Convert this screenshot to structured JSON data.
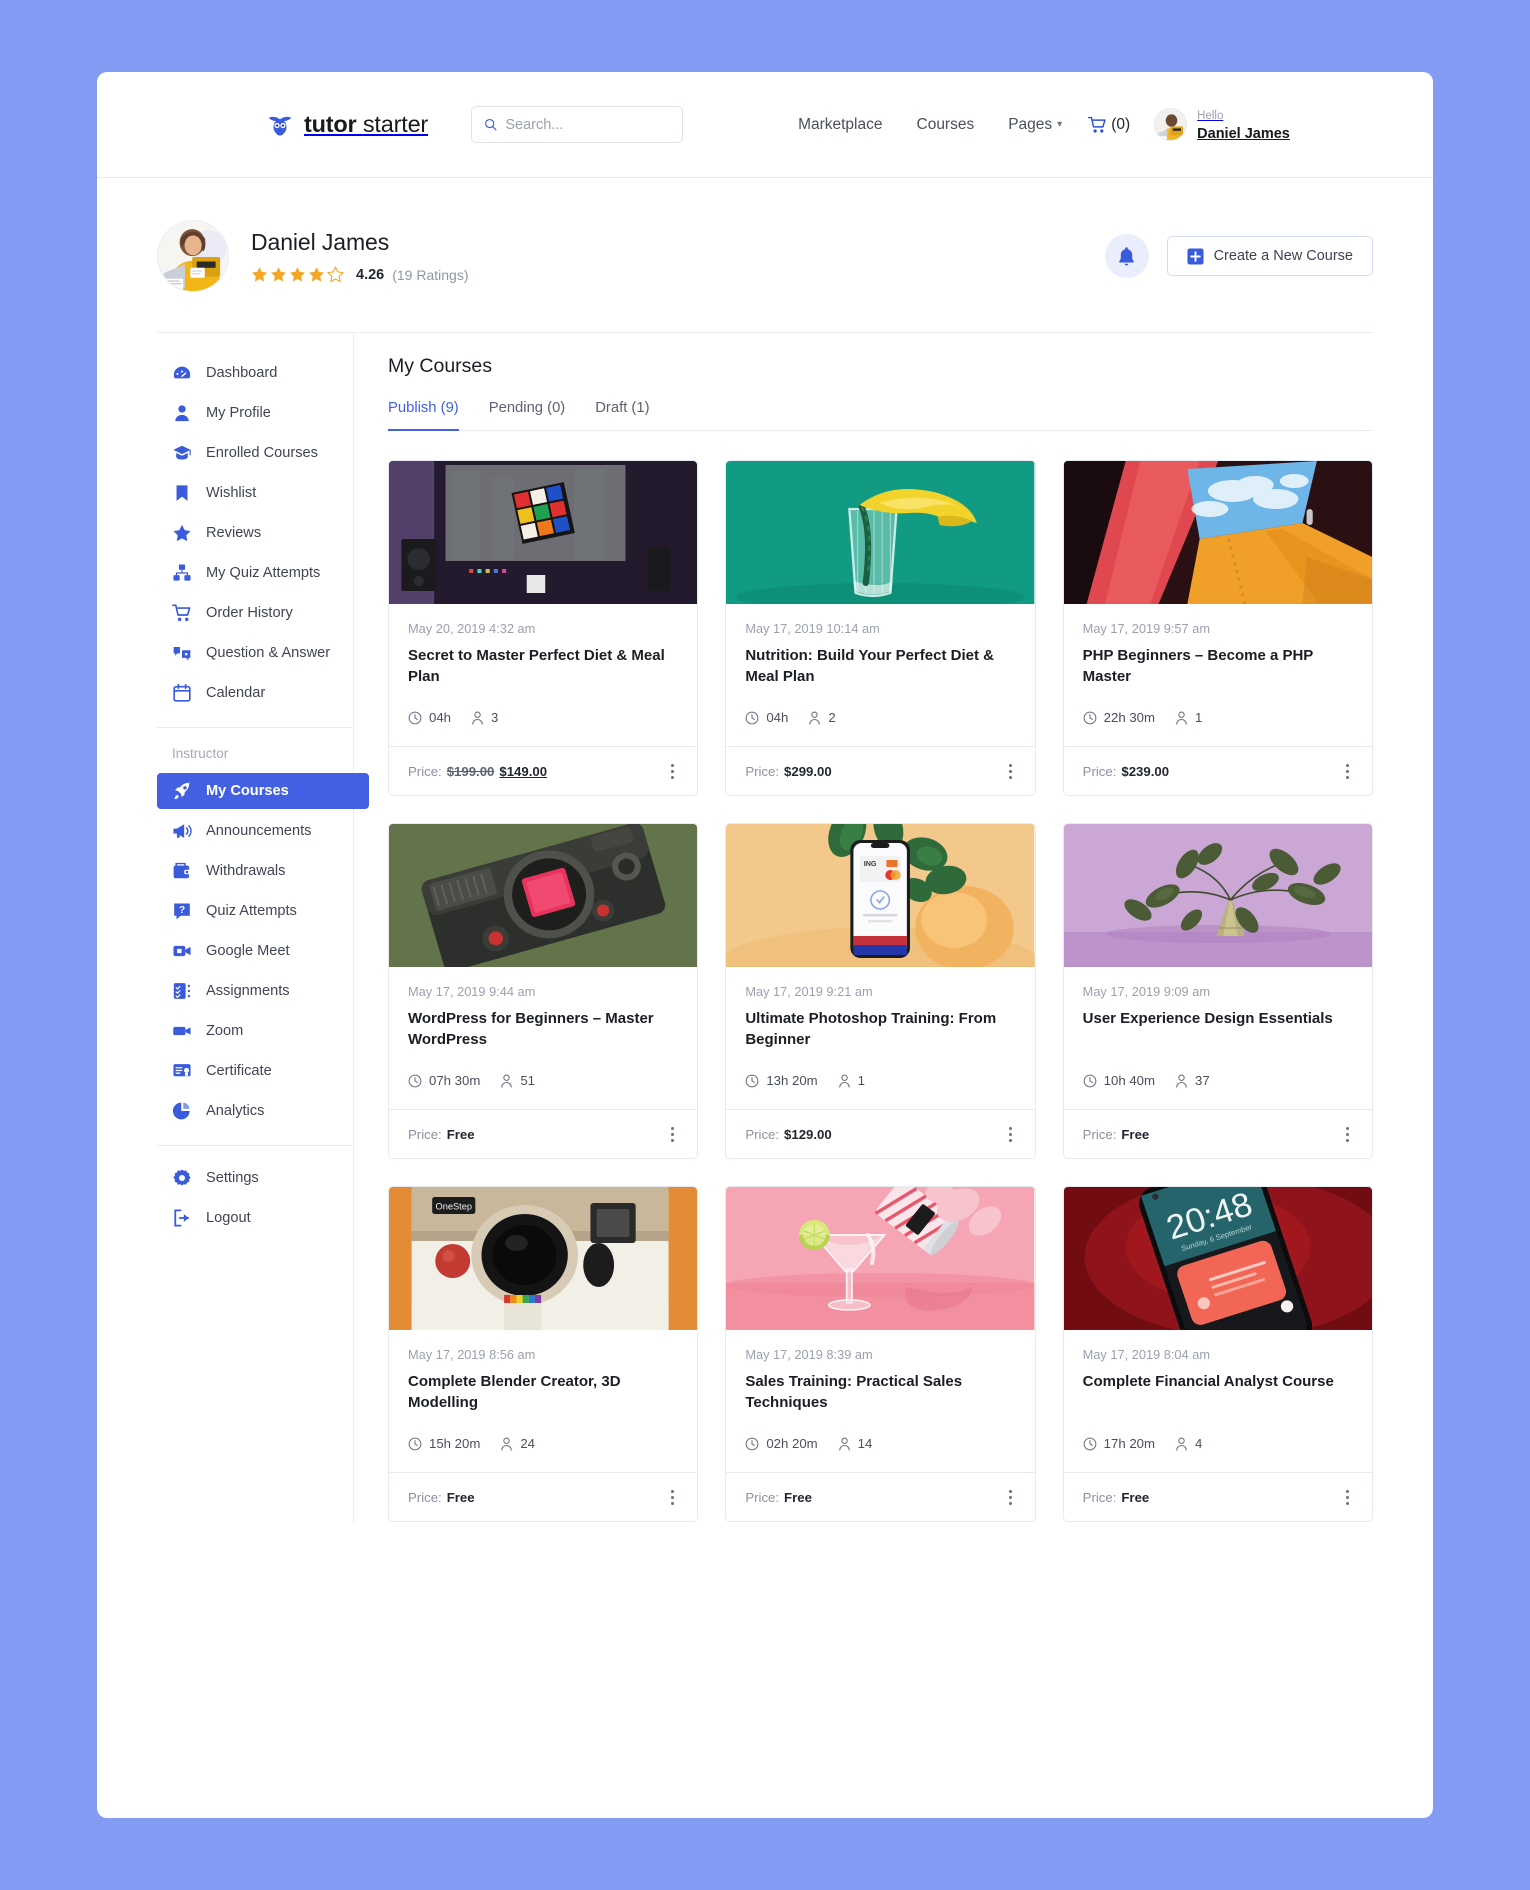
{
  "brand": {
    "name_bold": "tutor",
    "name_light": "starter",
    "icon": "owl-icon"
  },
  "search": {
    "placeholder": "Search...",
    "value": ""
  },
  "nav": {
    "items": [
      {
        "label": "Marketplace",
        "has_caret": false
      },
      {
        "label": "Courses",
        "has_caret": false
      },
      {
        "label": "Pages",
        "has_caret": true
      }
    ],
    "cart_label": "(0)",
    "cart_icon": "shopping-cart-icon",
    "hello": "Hello",
    "user_name": "Daniel James"
  },
  "profile": {
    "name": "Daniel James",
    "rating_value": "4.26",
    "rating_count": "(19 Ratings)",
    "stars_filled": 4,
    "stars_total": 5,
    "star_color": "#f5a623",
    "bell_icon": "bell-icon",
    "create_button": "Create a New Course",
    "create_icon": "plus-square-icon"
  },
  "sidebar": {
    "group1": [
      {
        "label": "Dashboard",
        "icon": "dashboard-icon"
      },
      {
        "label": "My Profile",
        "icon": "user-icon"
      },
      {
        "label": "Enrolled Courses",
        "icon": "graduation-cap-icon"
      },
      {
        "label": "Wishlist",
        "icon": "bookmark-icon"
      },
      {
        "label": "Reviews",
        "icon": "star-icon"
      },
      {
        "label": "My Quiz Attempts",
        "icon": "quiz-grid-icon"
      },
      {
        "label": "Order History",
        "icon": "cart-icon"
      },
      {
        "label": "Question & Answer",
        "icon": "question-answer-icon"
      },
      {
        "label": "Calendar",
        "icon": "calendar-icon"
      }
    ],
    "instructor_heading": "Instructor",
    "group2": [
      {
        "label": "My Courses",
        "icon": "rocket-icon",
        "active": true
      },
      {
        "label": "Announcements",
        "icon": "megaphone-icon",
        "active": false
      },
      {
        "label": "Withdrawals",
        "icon": "wallet-icon",
        "active": false
      },
      {
        "label": "Quiz Attempts",
        "icon": "quiz-question-icon",
        "active": false
      },
      {
        "label": "Google Meet",
        "icon": "video-camera-icon",
        "active": false
      },
      {
        "label": "Assignments",
        "icon": "assignment-list-icon",
        "active": false
      },
      {
        "label": "Zoom",
        "icon": "zoom-video-icon",
        "active": false
      },
      {
        "label": "Certificate",
        "icon": "certificate-icon",
        "active": false
      },
      {
        "label": "Analytics",
        "icon": "pie-chart-icon",
        "active": false
      }
    ],
    "group3": [
      {
        "label": "Settings",
        "icon": "gear-icon"
      },
      {
        "label": "Logout",
        "icon": "logout-icon"
      }
    ]
  },
  "main": {
    "title": "My Courses",
    "tabs": [
      {
        "label": "Publish (9)",
        "active": true
      },
      {
        "label": "Pending (0)",
        "active": false
      },
      {
        "label": "Draft (1)",
        "active": false
      }
    ],
    "price_label": "Price:",
    "clock_icon": "clock-icon",
    "student_icon": "student-icon",
    "kebab_icon": "more-vertical-icon"
  },
  "courses": [
    {
      "date": "May 20, 2019 4:32 am",
      "title": "Secret to Master Perfect Diet & Meal Plan",
      "duration": "04h",
      "students": "3",
      "price_old": "$199.00",
      "price_new": "$149.00",
      "price": "",
      "thumb": "rubiks-cube-dark-room"
    },
    {
      "date": "May 17, 2019 10:14 am",
      "title": "Nutrition: Build Your Perfect Diet & Meal Plan",
      "duration": "04h",
      "students": "2",
      "price_old": "",
      "price_new": "",
      "price": "$299.00",
      "thumb": "banana-glass-teal"
    },
    {
      "date": "May 17, 2019 9:57 am",
      "title": "PHP Beginners – Become a PHP Master",
      "duration": "22h 30m",
      "students": "1",
      "price_old": "",
      "price_new": "",
      "price": "$239.00",
      "thumb": "colorful-geometric-sky"
    },
    {
      "date": "May 17, 2019 9:44 am",
      "title": "WordPress for Beginners – Master WordPress",
      "duration": "07h 30m",
      "students": "51",
      "price_old": "",
      "price_new": "",
      "price": "Free",
      "thumb": "vintage-camera-green"
    },
    {
      "date": "May 17, 2019 9:21 am",
      "title": "Ultimate Photoshop Training: From Beginner",
      "duration": "13h 20m",
      "students": "1",
      "price_old": "",
      "price_new": "",
      "price": "$129.00",
      "thumb": "phone-payment-peach"
    },
    {
      "date": "May 17, 2019 9:09 am",
      "title": "User Experience Design Essentials",
      "duration": "10h 40m",
      "students": "37",
      "price_old": "",
      "price_new": "",
      "price": "Free",
      "thumb": "leaves-purple-backdrop"
    },
    {
      "date": "May 17, 2019 8:56 am",
      "title": "Complete Blender Creator, 3D Modelling",
      "duration": "15h 20m",
      "students": "24",
      "price_old": "",
      "price_new": "",
      "price": "Free",
      "thumb": "polaroid-onestep-camera"
    },
    {
      "date": "May 17, 2019 8:39 am",
      "title": "Sales Training: Practical Sales Techniques",
      "duration": "02h 20m",
      "students": "14",
      "price_old": "",
      "price_new": "",
      "price": "Free",
      "thumb": "cocktail-pink-pour"
    },
    {
      "date": "May 17, 2019 8:04 am",
      "title": "Complete Financial Analyst Course",
      "duration": "17h 20m",
      "students": "4",
      "price_old": "",
      "price_new": "",
      "price": "Free",
      "thumb": "smartphone-red-lockscreen"
    }
  ],
  "colors": {
    "accent": "#4360e3",
    "page_bg": "#839bf2",
    "star": "#f5a623"
  }
}
